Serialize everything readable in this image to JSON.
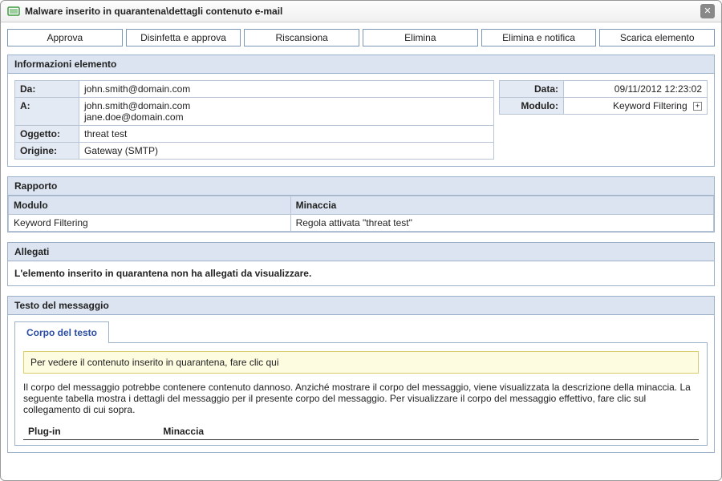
{
  "window": {
    "title": "Malware inserito in quarantena\\dettagli contenuto e-mail"
  },
  "toolbar": {
    "approve": "Approva",
    "disinfect_approve": "Disinfetta e approva",
    "rescan": "Riscansiona",
    "delete": "Elimina",
    "delete_notify": "Elimina e notifica",
    "download": "Scarica elemento"
  },
  "item_info": {
    "header": "Informazioni elemento",
    "from_label": "Da:",
    "from_value": "john.smith@domain.com",
    "to_label": "A:",
    "to_value": "john.smith@domain.com\njane.doe@domain.com",
    "subject_label": "Oggetto:",
    "subject_value": "threat test",
    "origin_label": "Origine:",
    "origin_value": "Gateway (SMTP)",
    "date_label": "Data:",
    "date_value": "09/11/2012 12:23:02",
    "module_label": "Modulo:",
    "module_value": "Keyword Filtering"
  },
  "report": {
    "header": "Rapporto",
    "col_module": "Modulo",
    "col_threat": "Minaccia",
    "rows": [
      {
        "module": "Keyword Filtering",
        "threat": "Regola attivata \"threat test\""
      }
    ]
  },
  "attachments": {
    "header": "Allegati",
    "empty_text": "L'elemento inserito in quarantena non ha allegati da visualizzare."
  },
  "message": {
    "header": "Testo del messaggio",
    "tab_label": "Corpo del testo",
    "warning_link": "Per vedere il contenuto inserito in quarantena, fare clic qui",
    "body_paragraph": "Il corpo del messaggio potrebbe contenere contenuto dannoso. Anziché mostrare il corpo del messaggio, viene visualizzata la descrizione della minaccia. La seguente tabella mostra i dettagli del messaggio per il presente corpo del messaggio. Per visualizzare il corpo del messaggio effettivo, fare clic sul collegamento di cui sopra.",
    "col_plugin": "Plug-in",
    "col_threat": "Minaccia"
  }
}
